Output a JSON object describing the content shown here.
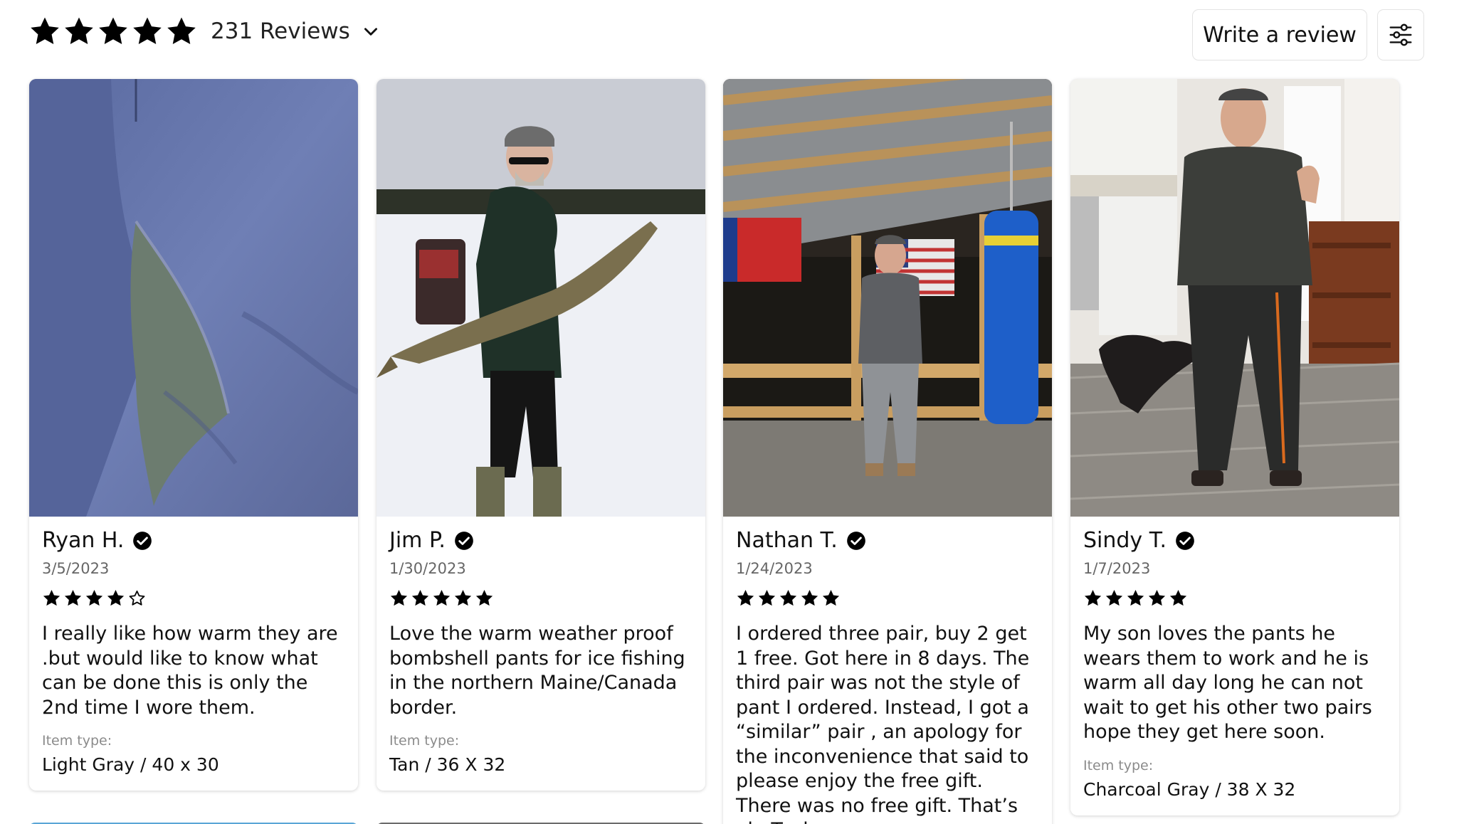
{
  "summary": {
    "rating": 5,
    "review_count_label": "231 Reviews",
    "star_icon": "star-icon",
    "chevron_icon": "chevron-down-icon"
  },
  "actions": {
    "write_review_label": "Write a review",
    "filter_icon": "sliders-icon"
  },
  "colors": {
    "star": "#000000",
    "card_border": "#e3e3e3",
    "muted_text": "#666666",
    "label_text": "#8b8b8b"
  },
  "reviews": [
    {
      "name": "Ryan H.",
      "date": "3/5/2023",
      "rating": 4,
      "text": "I really like how warm they are .but would like to know what can be done this is only the 2nd time I wore them.",
      "item_type_label": "Item type:",
      "item_type": "Light Gray / 40 x 30",
      "photo": "torn pants fabric photo"
    },
    {
      "name": "Jim P.",
      "date": "1/30/2023",
      "rating": 5,
      "text": "Love the warm weather proof bombshell pants for ice fishing in the northern Maine/Canada border.",
      "item_type_label": "Item type:",
      "item_type": "Tan / 36 X 32",
      "photo": "man holding fish on frozen lake photo"
    },
    {
      "name": "Nathan T.",
      "date": "1/24/2023",
      "rating": 5,
      "text": "I ordered three pair, buy 2 get 1 free. Got here in 8 days. The third pair was not the style of pant I ordered. Instead, I got a “similar” pair , an apology for the inconvenience that said to please enjoy the free gift. There was no free gift. That’s ok. Took",
      "item_type_label": "",
      "item_type": "",
      "photo": "man standing under porch with punching bag photo"
    },
    {
      "name": "Sindy T.",
      "date": "1/7/2023",
      "rating": 5,
      "text": "My son loves the pants he wears them to work and he is warm all day long he can not wait to get his other two pairs hope they get here soon.",
      "item_type_label": "Item type:",
      "item_type": "Charcoal Gray / 38 X 32",
      "photo": "man in kitchen with dog photo"
    }
  ]
}
